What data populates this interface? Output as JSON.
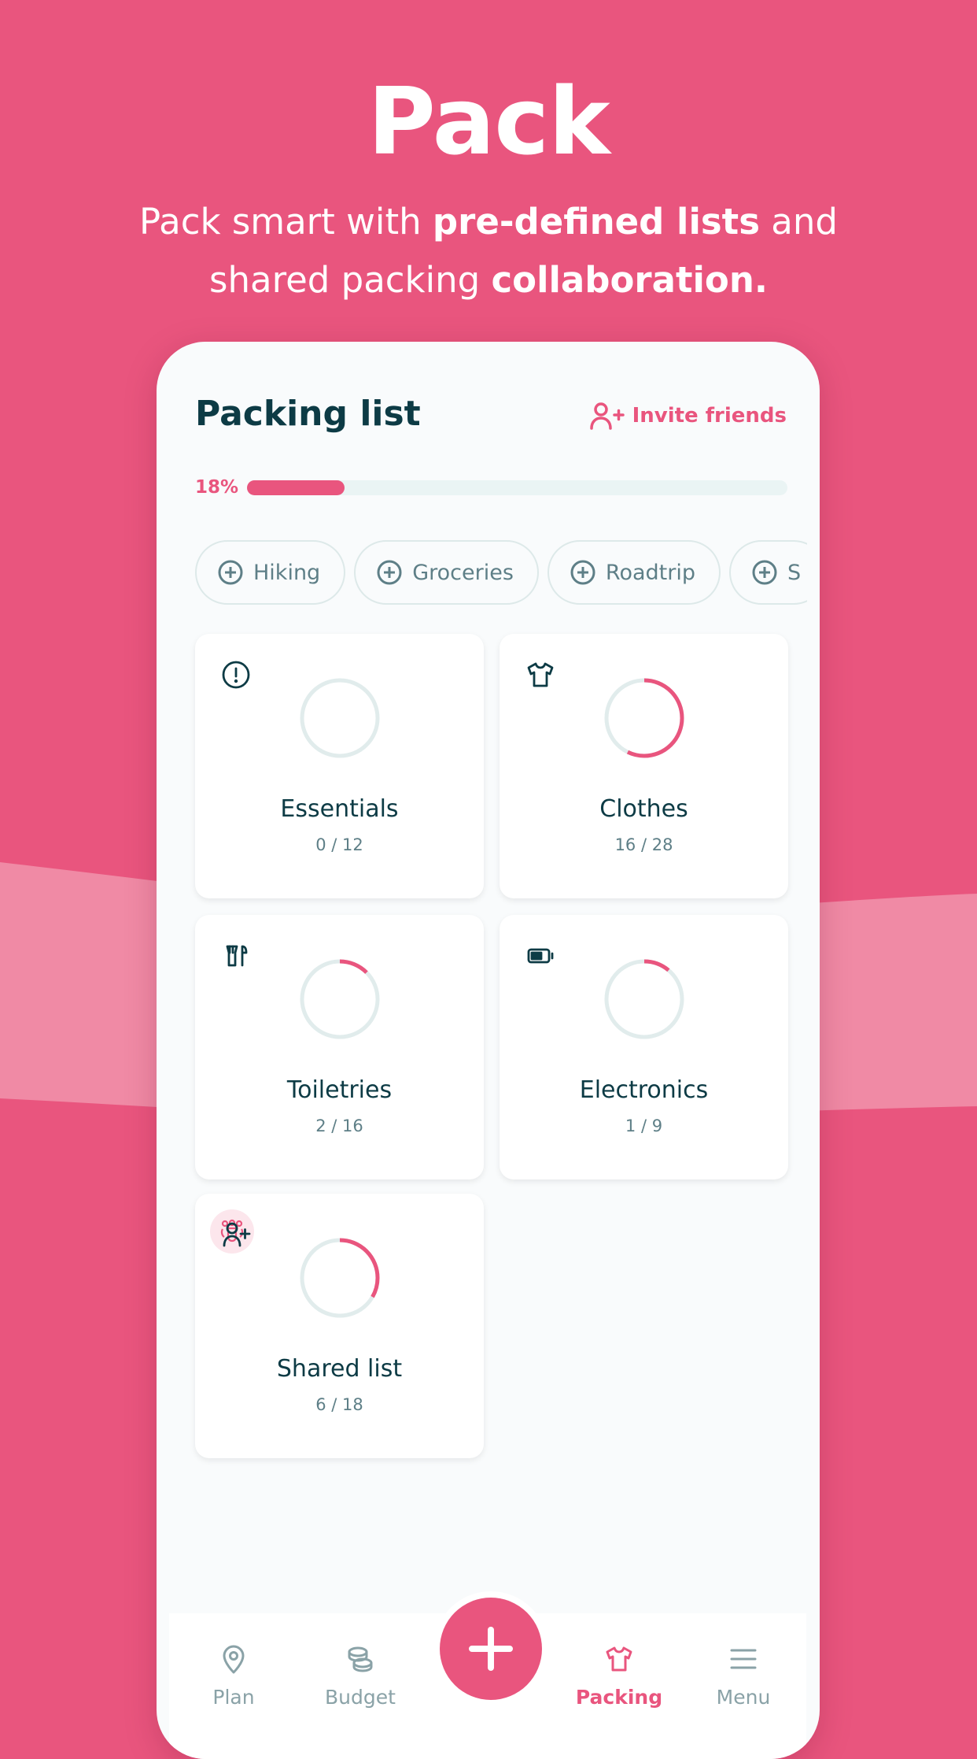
{
  "hero": {
    "title": "Pack",
    "line1_pre": "Pack smart with ",
    "line1_bold": "pre-defined lists",
    "line1_post": " and",
    "line2_pre": "shared packing ",
    "line2_bold": "collaboration."
  },
  "colors": {
    "brand": "#E9557E",
    "brand_light": "#F08AA5",
    "text_dark": "#0D3B45",
    "text_muted": "#5E7F87",
    "ring_track": "#E1ECEC"
  },
  "header": {
    "title": "Packing list",
    "invite_label": "Invite friends",
    "invite_icon": "user-plus-icon"
  },
  "progress": {
    "label": "18%",
    "value": 18
  },
  "chips": [
    {
      "label": "Hiking"
    },
    {
      "label": "Groceries"
    },
    {
      "label": "Roadtrip"
    },
    {
      "label": "S"
    }
  ],
  "lists": [
    {
      "title": "Essentials",
      "count": "0 / 12",
      "done": 0,
      "total": 12,
      "icon": "alert-circle-icon"
    },
    {
      "title": "Clothes",
      "count": "16 / 28",
      "done": 16,
      "total": 28,
      "icon": "tshirt-icon"
    },
    {
      "title": "Toiletries",
      "count": "2 / 16",
      "done": 2,
      "total": 16,
      "icon": "toiletries-icon"
    },
    {
      "title": "Electronics",
      "count": "1 / 9",
      "done": 1,
      "total": 9,
      "icon": "battery-icon"
    },
    {
      "title": "Shared list",
      "count": "6 / 18",
      "done": 6,
      "total": 18,
      "icon": "user-plus-icon",
      "shared": true
    }
  ],
  "nav": {
    "items": [
      {
        "label": "Plan",
        "icon": "map-pin-icon"
      },
      {
        "label": "Budget",
        "icon": "coins-icon"
      },
      {
        "label": "Packing",
        "icon": "tshirt-icon",
        "active": true
      },
      {
        "label": "Menu",
        "icon": "menu-icon"
      }
    ],
    "fab_icon": "plus-icon"
  }
}
